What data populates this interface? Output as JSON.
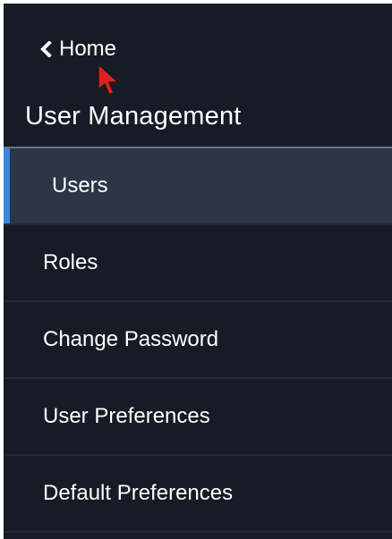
{
  "nav": {
    "back_label": "Home",
    "section_title": "User Management",
    "items": [
      {
        "label": "Users",
        "active": true
      },
      {
        "label": "Roles",
        "active": false
      },
      {
        "label": "Change Password",
        "active": false
      },
      {
        "label": "User Preferences",
        "active": false
      },
      {
        "label": "Default Preferences",
        "active": false
      }
    ]
  },
  "colors": {
    "panel_bg": "#161b26",
    "active_bg": "#2d3647",
    "active_accent": "#3b86d6",
    "cursor": "#e02020"
  },
  "icons": {
    "back": "chevron-left-icon",
    "pointer": "mouse-cursor-icon"
  }
}
